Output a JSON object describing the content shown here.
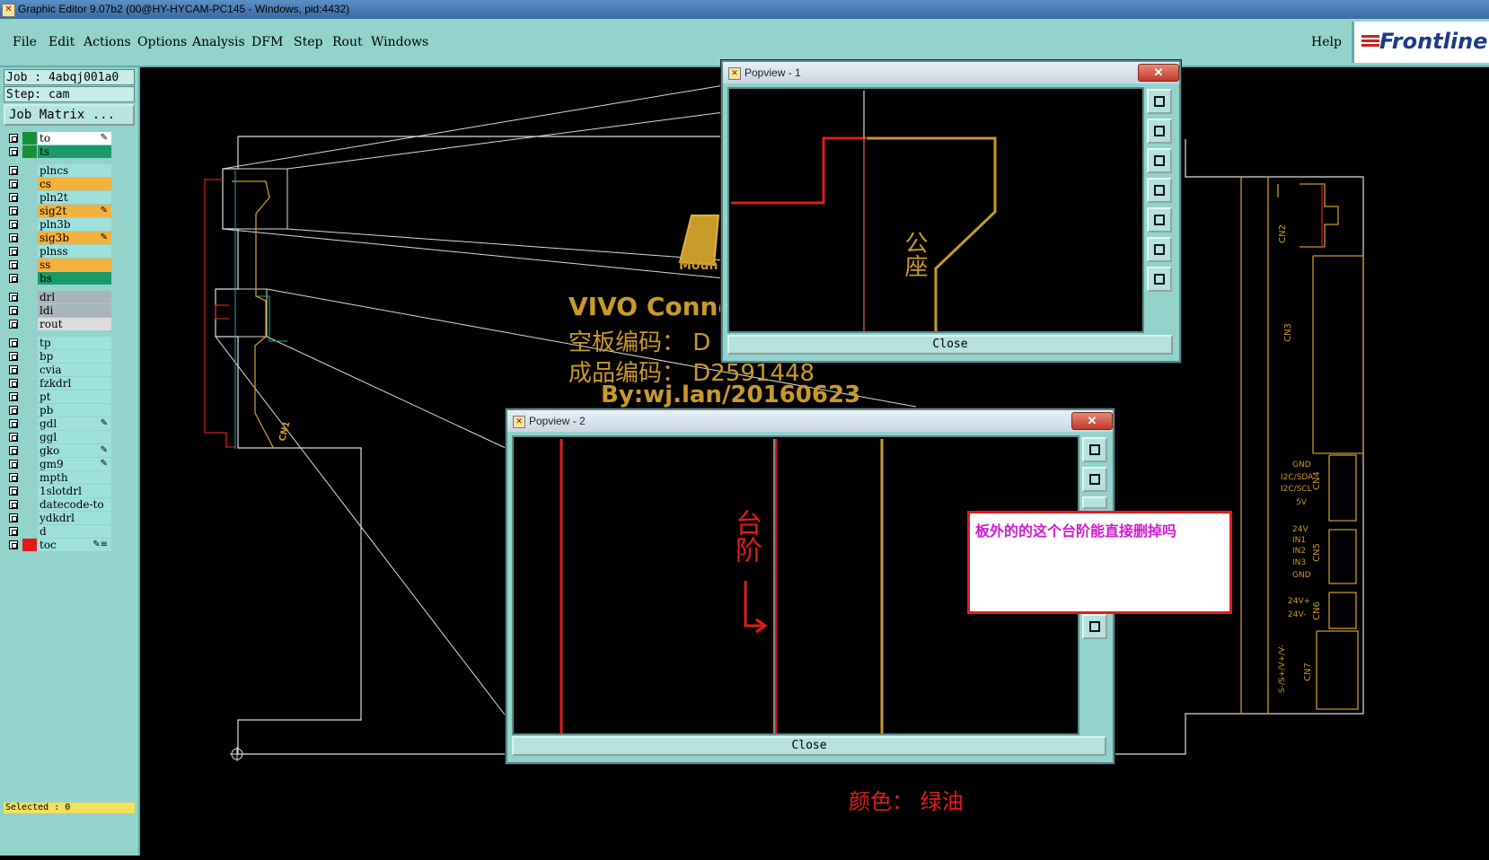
{
  "window": {
    "title": "Graphic Editor 9.07b2 (00@HY-HYCAM-PC145 - Windows, pid:4432)"
  },
  "menu": {
    "items": [
      "File",
      "Edit",
      "Actions",
      "Options",
      "Analysis",
      "DFM",
      "Step",
      "Rout",
      "Windows"
    ],
    "help": "Help",
    "brand": "Frontline"
  },
  "job": {
    "job_label": "Job : 4abqj001a0",
    "step_label": "Step: cam",
    "matrix_button": "Job Matrix ..."
  },
  "layers": [
    {
      "name": "to",
      "color": "#ffffff",
      "swatch": "#1a8f3a",
      "mark": "✎"
    },
    {
      "name": "ts",
      "color": "#1a9a6a",
      "swatch": "#1a8f3a",
      "mark": ""
    },
    {
      "name": "plncs",
      "color": "#9ee0dc",
      "swatch": "",
      "mark": ""
    },
    {
      "name": "cs",
      "color": "#f4b13c",
      "swatch": "",
      "mark": ""
    },
    {
      "name": "pln2t",
      "color": "#9ee0dc",
      "swatch": "",
      "mark": ""
    },
    {
      "name": "sig2t",
      "color": "#f4b13c",
      "swatch": "",
      "mark": "✎"
    },
    {
      "name": "pln3b",
      "color": "#9ee0dc",
      "swatch": "",
      "mark": ""
    },
    {
      "name": "sig3b",
      "color": "#f4b13c",
      "swatch": "",
      "mark": "✎"
    },
    {
      "name": "plnss",
      "color": "#9ee0dc",
      "swatch": "",
      "mark": ""
    },
    {
      "name": "ss",
      "color": "#f4b13c",
      "swatch": "",
      "mark": ""
    },
    {
      "name": "bs",
      "color": "#1a9a6a",
      "swatch": "",
      "mark": ""
    },
    {
      "name": "drl",
      "color": "#a9b5bb",
      "swatch": "",
      "mark": ""
    },
    {
      "name": "ldi",
      "color": "#a9b5bb",
      "swatch": "",
      "mark": ""
    },
    {
      "name": "rout",
      "color": "#dcdcdc",
      "swatch": "",
      "mark": ""
    },
    {
      "name": "tp",
      "color": "#9ee0dc",
      "swatch": "",
      "mark": ""
    },
    {
      "name": "bp",
      "color": "#9ee0dc",
      "swatch": "",
      "mark": ""
    },
    {
      "name": "cvia",
      "color": "#9ee0dc",
      "swatch": "",
      "mark": ""
    },
    {
      "name": "fzkdrl",
      "color": "#9ee0dc",
      "swatch": "",
      "mark": ""
    },
    {
      "name": "pt",
      "color": "#9ee0dc",
      "swatch": "",
      "mark": ""
    },
    {
      "name": "pb",
      "color": "#9ee0dc",
      "swatch": "",
      "mark": ""
    },
    {
      "name": "gdl",
      "color": "#9ee0dc",
      "swatch": "",
      "mark": "✎"
    },
    {
      "name": "ggl",
      "color": "#9ee0dc",
      "swatch": "",
      "mark": ""
    },
    {
      "name": "gko",
      "color": "#9ee0dc",
      "swatch": "",
      "mark": "✎"
    },
    {
      "name": "gm9",
      "color": "#9ee0dc",
      "swatch": "",
      "mark": "✎"
    },
    {
      "name": "mpth",
      "color": "#9ee0dc",
      "swatch": "",
      "mark": ""
    },
    {
      "name": "1slotdrl",
      "color": "#9ee0dc",
      "swatch": "",
      "mark": ""
    },
    {
      "name": "datecode-to",
      "color": "#9ee0dc",
      "swatch": "",
      "mark": ""
    },
    {
      "name": "ydkdrl",
      "color": "#9ee0dc",
      "swatch": "",
      "mark": ""
    },
    {
      "name": "d",
      "color": "#9ee0dc",
      "swatch": "",
      "mark": ""
    },
    {
      "name": "toc",
      "color": "#9ee0dc",
      "swatch": "#e01b1b",
      "mark": "✎≡"
    }
  ],
  "status": {
    "selected": "Selected : 0"
  },
  "canvas_text": {
    "logo_sub": "Moun",
    "line1": "VIVO  Conne",
    "line2": "空板编码： D",
    "line3": "成品编码： D2591448",
    "line4": "By:wj.lan/20160623",
    "cn1": "CN1",
    "cn2": "CN2",
    "cn3": "CN3",
    "cn4": "CN4",
    "cn5": "CN5",
    "cn6": "CN6",
    "cn7": "CN7",
    "gnd": "GND",
    "sda": "I2C/SDA",
    "scl": "I2C/SCL",
    "v5": "5V",
    "v24": "24V",
    "in1": "IN1",
    "in2": "IN2",
    "in3": "IN3",
    "gnd2": "GND",
    "v24p": "24V+",
    "v24m": "24V-",
    "rs": "S-/S+/V+/V-"
  },
  "popview1": {
    "title": "Popview - 1",
    "close": "Close",
    "label": "公座"
  },
  "popview2": {
    "title": "Popview - 2",
    "close": "Close",
    "label": "台阶"
  },
  "note": {
    "text": "板外的的这个台阶能直接删掉吗"
  },
  "bottom_note": {
    "text": "颜色： 绿油"
  }
}
